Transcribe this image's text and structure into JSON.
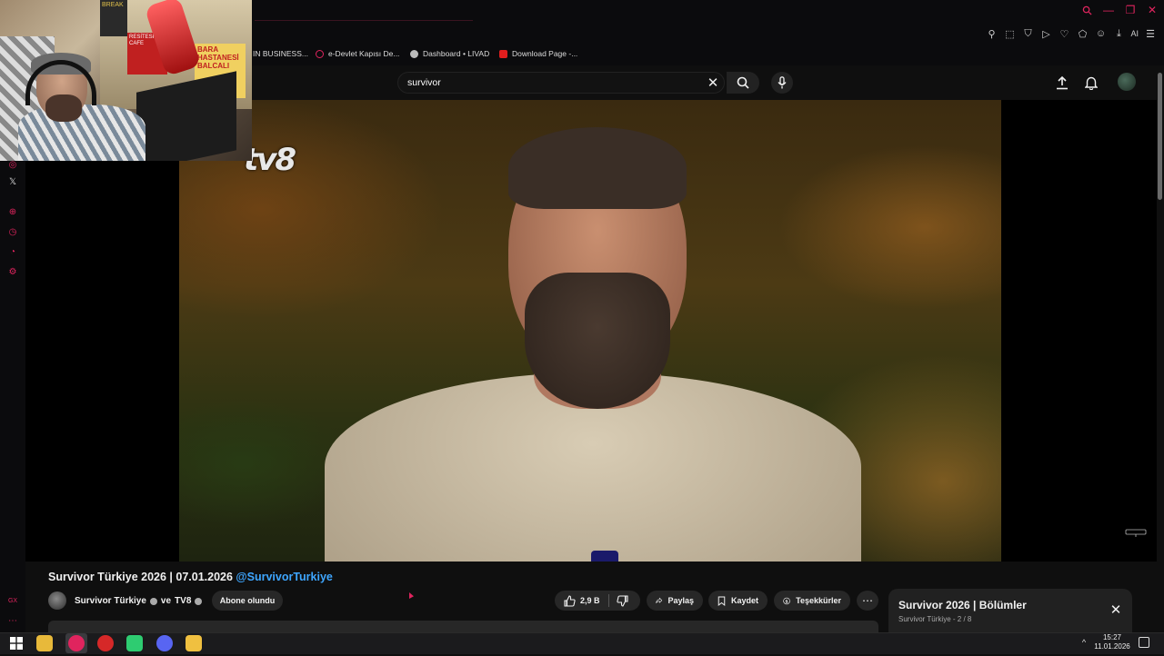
{
  "browser": {
    "bookmarks": [
      {
        "label": "K IN BUSINESS...",
        "icon": "bookmark-icon",
        "color": "#cccccc"
      },
      {
        "label": "e-Devlet Kapısı De...",
        "icon": "edevlet-icon",
        "color": "#e0245e"
      },
      {
        "label": "Dashboard • LIVAD",
        "icon": "dashboard-icon",
        "color": "#bbbbbb"
      },
      {
        "label": "Download Page -...",
        "icon": "download-page-icon",
        "color": "#e01e1e"
      }
    ],
    "extensions": {
      "ai_label": "AI"
    },
    "accent_color": "#e0245e"
  },
  "youtube": {
    "search": {
      "value": "survivor"
    },
    "video": {
      "watermark": "tv8"
    },
    "title": {
      "text": "Survivor Türkiye 2026 | 07.01.2026 ",
      "mention": "@SurvivorTurkiye"
    },
    "channel": {
      "name": "Survivor Türkiye",
      "collab_prefix": "ve",
      "collab_name": "TV8"
    },
    "subscribe_label": "Abone olundu",
    "actions": {
      "like_count": "2,9 B",
      "share_label": "Paylaş",
      "save_label": "Kaydet",
      "thanks_label": "Teşekkürler",
      "more_label": "⋯"
    },
    "playlist": {
      "title": "Survivor 2026 | Bölümler",
      "channel": "Survivor Türkiye",
      "position": "2 / 8"
    }
  },
  "webcam": {
    "sign_top": "BREAK",
    "sign_cafe": "RESİTESİ CAFE",
    "sign_hospital": "BARA HASTANESİ BALCALI"
  },
  "taskbar": {
    "time": "15:27",
    "date": "11.01.2026"
  }
}
